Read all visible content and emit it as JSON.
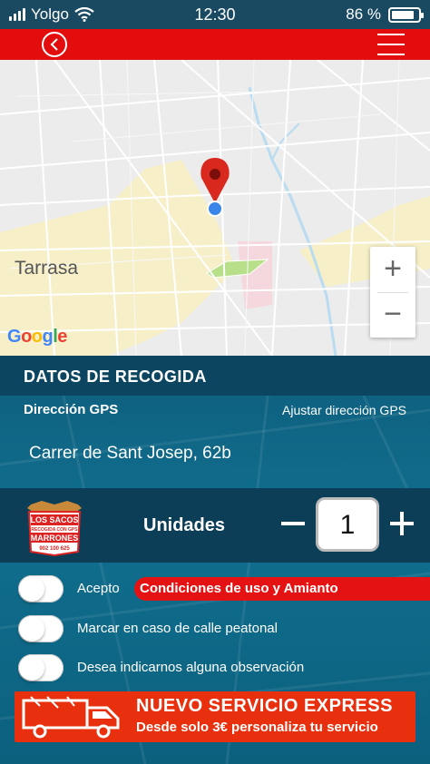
{
  "status_bar": {
    "carrier": "Yolgo",
    "time": "12:30",
    "battery_text": "86 %",
    "battery_level": 0.86,
    "icons": [
      "signal-icon",
      "wifi-icon",
      "battery-icon"
    ]
  },
  "header": {
    "icons": [
      "back-icon",
      "menu-icon"
    ],
    "color": "#e30d0d"
  },
  "map": {
    "city_label": "Tarrasa",
    "provider_label": "Google",
    "zoom_in": "+",
    "zoom_out": "−",
    "icons": [
      "location-pin-icon",
      "current-location-dot-icon"
    ]
  },
  "form": {
    "title": "DATOS DE RECOGIDA",
    "gps_label": "Dirección GPS",
    "gps_adjust_link": "Ajustar dirección GPS",
    "address": "Carrer de Sant Josep, 62b",
    "logo": {
      "line1": "LOS SACOS",
      "line2": "RECOGIDA CON GPS",
      "line3": "MARRONES",
      "phone": "902 100 625"
    },
    "units_label": "Unidades",
    "units_value": "1",
    "minus_label": "−",
    "plus_label": "+",
    "accept_label": "Acepto",
    "conditions_link": "Condiciones de uso y Amianto",
    "pedestrian_label": "Marcar en caso de calle peatonal",
    "observation_label": "Desea indicarnos alguna observación",
    "toggles": {
      "accept": false,
      "pedestrian": false,
      "observation": false
    }
  },
  "express": {
    "title": "NUEVO SERVICIO EXPRESS",
    "subtitle": "Desde solo 3€ personaliza tu servicio",
    "icon": "truck-icon",
    "color": "#e8300e"
  },
  "colors": {
    "accent_red": "#e30d0d",
    "form_bg": "#116f8f",
    "dark_band": "#0b4560"
  }
}
